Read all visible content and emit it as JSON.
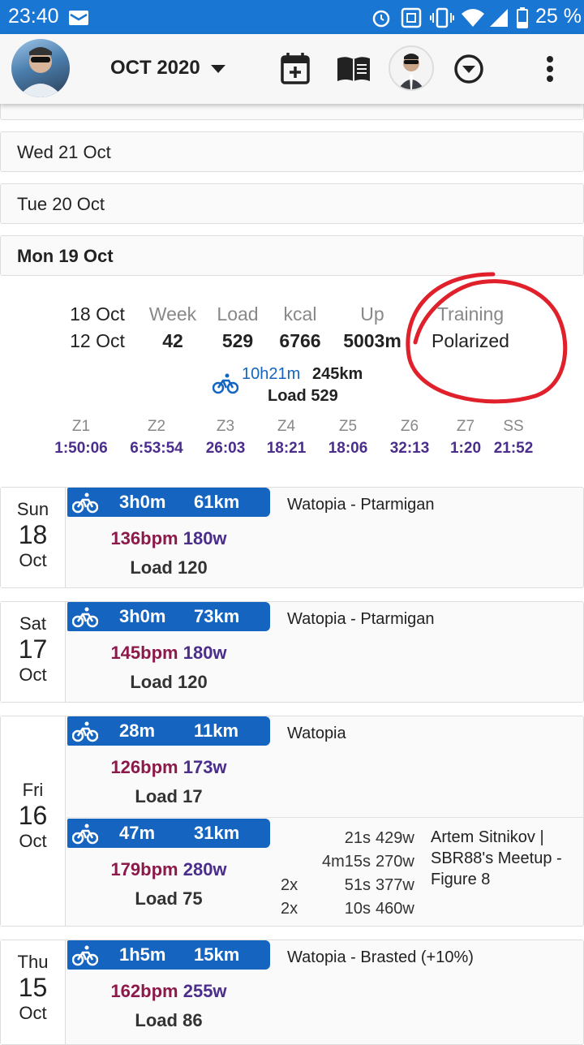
{
  "status": {
    "time": "23:40",
    "battery": "25 %"
  },
  "appbar": {
    "month": "OCT 2020",
    "icons": [
      "calendar-add-icon",
      "book-icon",
      "dropdown-circle-icon",
      "more-vert-icon"
    ]
  },
  "day_headers": [
    {
      "label": "Wed  21 Oct",
      "bold": false
    },
    {
      "label": "Tue  20 Oct",
      "bold": false
    },
    {
      "label": "Mon  19 Oct",
      "bold": true
    }
  ],
  "summary": {
    "range_end": "18 Oct",
    "range_start": "12 Oct",
    "week_h": "Week",
    "week_v": "42",
    "load_h": "Load",
    "load_v": "529",
    "kcal_h": "kcal",
    "kcal_v": "6766",
    "up_h": "Up",
    "up_v": "5003m",
    "training_h": "Training",
    "training_v": "Polarized",
    "ride_time": "10h21m",
    "ride_dist": "245km",
    "ride_load": "Load 529",
    "zones": [
      {
        "z": "Z1",
        "t": "1:50:06"
      },
      {
        "z": "Z2",
        "t": "6:53:54"
      },
      {
        "z": "Z3",
        "t": "26:03"
      },
      {
        "z": "Z4",
        "t": "18:21"
      },
      {
        "z": "Z5",
        "t": "18:06"
      },
      {
        "z": "Z6",
        "t": "32:13"
      },
      {
        "z": "Z7",
        "t": "1:20"
      },
      {
        "z": "SS",
        "t": "21:52"
      }
    ]
  },
  "days": [
    {
      "dow": "Sun",
      "num": "18",
      "mon": "Oct",
      "acts": [
        {
          "dur": "3h0m",
          "dist": "61km",
          "bpm": "136bpm",
          "watts": "180w",
          "load": "Load 120",
          "name": "Watopia - Ptarmigan"
        }
      ]
    },
    {
      "dow": "Sat",
      "num": "17",
      "mon": "Oct",
      "acts": [
        {
          "dur": "3h0m",
          "dist": "73km",
          "bpm": "145bpm",
          "watts": "180w",
          "load": "Load 120",
          "name": "Watopia - Ptarmigan"
        }
      ]
    },
    {
      "dow": "Fri",
      "num": "16",
      "mon": "Oct",
      "acts": [
        {
          "dur": "28m",
          "dist": "11km",
          "bpm": "126bpm",
          "watts": "173w",
          "load": "Load 17",
          "name": "Watopia"
        },
        {
          "dur": "47m",
          "dist": "31km",
          "bpm": "179bpm",
          "watts": "280w",
          "load": "Load 75",
          "name": "Artem Sitnikov | SBR88's Meetup - Figure 8",
          "name_lines": [
            "Artem Sitnikov |",
            "SBR88's Meetup -",
            "Figure 8"
          ],
          "intervals": [
            {
              "rep": "",
              "dur": "21s",
              "pw": "429w"
            },
            {
              "rep": "",
              "dur": "4m15s",
              "pw": "270w"
            },
            {
              "rep": "2x",
              "dur": "51s",
              "pw": "377w"
            },
            {
              "rep": "2x",
              "dur": "10s",
              "pw": "460w"
            }
          ]
        }
      ]
    },
    {
      "dow": "Thu",
      "num": "15",
      "mon": "Oct",
      "acts": [
        {
          "dur": "1h5m",
          "dist": "15km",
          "bpm": "162bpm",
          "watts": "255w",
          "load": "Load 86",
          "name": "Watopia - Brasted (+10%)"
        }
      ]
    }
  ],
  "colors": {
    "statusbar": "#1976d2",
    "bar": "#1565c0",
    "bpm": "#8b1a4a",
    "watts": "#4b2d8c",
    "annotation": "#e0202a"
  }
}
